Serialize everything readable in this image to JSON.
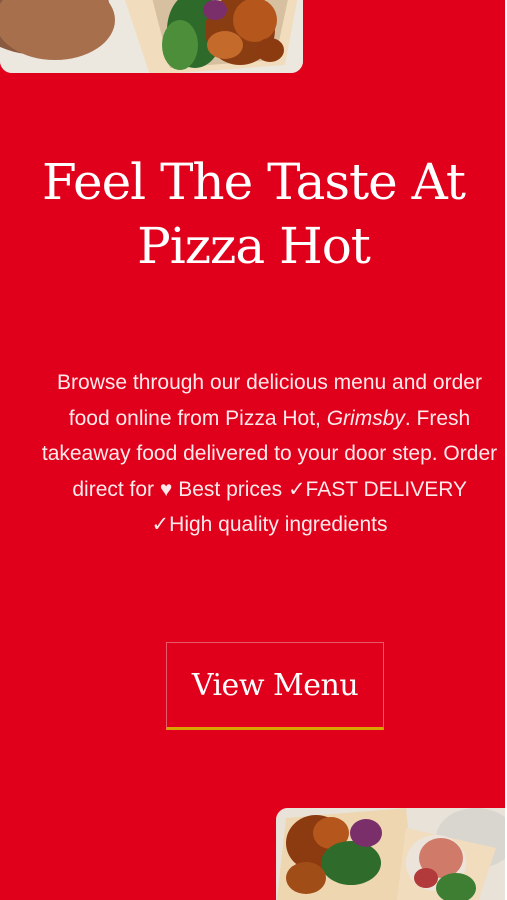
{
  "hero": {
    "headline": "Feel The Taste At Pizza Hot",
    "description_part1": "Browse through our delicious menu and order food online from Pizza Hot,",
    "description_location": "Grimsby",
    "description_part2": ". Fresh takeaway food delivered to your door step. Order direct for",
    "heart_glyph": "♥",
    "description_part3": "Best prices",
    "check_glyph": "✓",
    "feature_1": "FAST DELIVERY",
    "feature_2": "High quality ingredients",
    "cta_label": "View Menu"
  },
  "colors": {
    "background": "#e0001b",
    "text": "#ffffff",
    "cta_underline": "#d9a300"
  },
  "icons": {
    "heart": "heart-icon",
    "check": "check-icon"
  }
}
